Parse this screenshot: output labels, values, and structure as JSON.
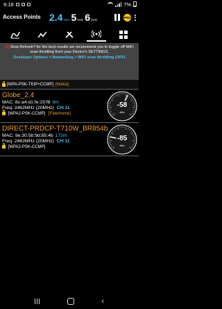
{
  "status_bar": {
    "time": "9:18",
    "battery": "7%"
  },
  "header": {
    "title": "Access Points"
  },
  "bands": [
    {
      "num": "2.4",
      "unit": "GHz"
    },
    {
      "num": "5",
      "unit": "GHz"
    },
    {
      "num": "6",
      "unit": "GHz"
    }
  ],
  "pro_badge": "PRO",
  "tabs": [
    "graph-icon",
    "chart-icon",
    "tools-icon",
    "access-points-icon",
    "grid-icon"
  ],
  "banner": {
    "exclamation": "[!]",
    "message": "Slow Refresh? for the best results we recommend you to toggle off WiFi scan throttling from your Device's SETTINGS.",
    "path": "Developer Options > Networking > WiFi scan throttling (OFF)"
  },
  "partial_row": {
    "encryption": "[WPA-PSK-TKIP+CCMP]",
    "vendor": "[Nokia]"
  },
  "access_points": [
    {
      "ssid": "Globe_2.4",
      "mac": "MAC: 6c:a4:d1:fe:23:f8",
      "distance": "8m",
      "freq": "Freq: 2462MHz (20MHz)",
      "channel": "CH 11",
      "encryption": "[WPA2-PSK-CCMP]",
      "vendor": "[Fiberhome]",
      "signal": "-58",
      "signal_unit": "dBm",
      "signal_level": -58,
      "ring_color": "#ffffff"
    },
    {
      "ssid": "DIRECT-PRDCP-T710W_BR854b",
      "mac": "MAC: 9e:30:5b:9d:85:4b",
      "distance": "172m",
      "freq": "Freq: 2462MHz (20MHz)",
      "channel": "CH 11",
      "encryption": "[WPA2-PSK-CCMP]",
      "vendor": "",
      "signal": "-85",
      "signal_unit": "dBm",
      "signal_level": -85,
      "ring_color": "#ffffff"
    }
  ],
  "colors": {
    "accent": "#4fc3f7",
    "ssid": "#f0a030",
    "banner_bg": "#444444"
  }
}
